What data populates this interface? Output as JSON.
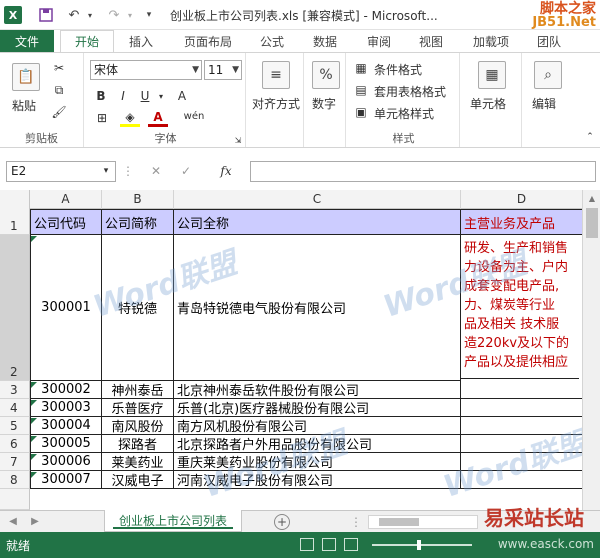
{
  "title_bar": {
    "app_icon": "excel-logo",
    "title": "创业板上市公司列表.xls  [兼容模式] - Microsoft...",
    "brand_line1": "脚本之家",
    "brand_line2": "JB51.Net"
  },
  "tabs": [
    "文件",
    "开始",
    "插入",
    "页面布局",
    "公式",
    "数据",
    "审阅",
    "视图",
    "加载项",
    "团队"
  ],
  "ribbon": {
    "paste": "粘贴",
    "clipboard_group": "剪贴板",
    "font_name": "宋体",
    "font_size": "11",
    "font_group": "字体",
    "bold": "B",
    "italic": "I",
    "underline": "U",
    "grow_font": "A",
    "wen": "wén",
    "alignment": "对齐方式",
    "number": "数字",
    "percent": "%",
    "conditional_format": "条件格式",
    "table_format": "套用表格格式",
    "cell_style": "单元格样式",
    "styles_group": "样式",
    "cells": "单元格",
    "editing": "编辑"
  },
  "formula_bar": {
    "name_box": "E2",
    "fx": "fx",
    "formula": ""
  },
  "columns": [
    "A",
    "B",
    "C",
    "D"
  ],
  "rows": [
    "1",
    "2",
    "3",
    "4",
    "5",
    "6",
    "7",
    "8"
  ],
  "table": {
    "headers": [
      "公司代码",
      "公司简称",
      "公司全称",
      "主营业务及产品"
    ],
    "row2": {
      "code": "300001",
      "short": "特锐德",
      "full": "青岛特锐德电气股份有限公司",
      "business": [
        "研发、生产和销售",
        "力设备为主、户内",
        "成套变配电产品,",
        "力、煤炭等行业",
        "品及相关 技术服",
        "造220kv及以下的",
        "产品以及提供相应"
      ]
    },
    "rows": [
      {
        "code": "300002",
        "short": "神州泰岳",
        "full": "北京神州泰岳软件股份有限公司"
      },
      {
        "code": "300003",
        "short": "乐普医疗",
        "full": "乐普(北京)医疗器械股份有限公司"
      },
      {
        "code": "300004",
        "short": "南风股份",
        "full": "南方风机股份有限公司"
      },
      {
        "code": "300005",
        "short": "探路者",
        "full": "北京探路者户外用品股份有限公司"
      },
      {
        "code": "300006",
        "short": "莱美药业",
        "full": "重庆莱美药业股份有限公司"
      },
      {
        "code": "300007",
        "short": "汉威电子",
        "full": "河南汉威电子股份有限公司"
      }
    ]
  },
  "sheet_tab": "创业板上市公司列表",
  "add_sheet": "+",
  "watermark": "Word联盟",
  "watermark_bottom": "易采站长站",
  "status": {
    "text": "就绪",
    "site": "www.easck.com",
    "zoom_percent": 47
  }
}
